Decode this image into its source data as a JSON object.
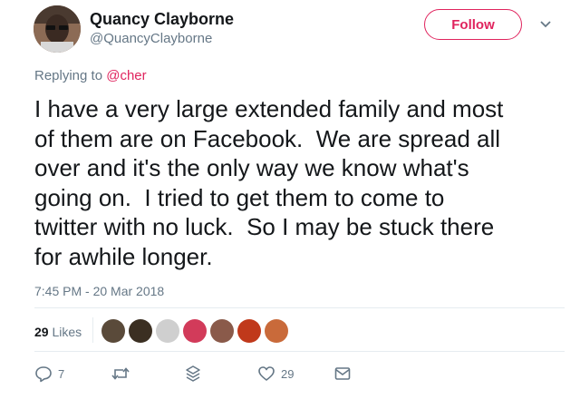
{
  "author": {
    "name": "Quancy Clayborne",
    "handle": "@QuancyClayborne"
  },
  "follow_label": "Follow",
  "reply_context": {
    "prefix": "Replying to",
    "mention": "@cher"
  },
  "tweet": {
    "text": "I have a very large extended family and most\nof them are on Facebook.  We are spread all\nover and it's the only way we know what's\ngoing on.  I tried to get them to come to\ntwitter with no luck.  So I may be stuck there\nfor awhile longer.",
    "timestamp": "7:45 PM - 20 Mar 2018"
  },
  "stats": {
    "likes_count": "29",
    "likes_label": "Likes"
  },
  "likers": [
    {
      "icon": "liker-avatar-1",
      "color": "#5a4a3a"
    },
    {
      "icon": "liker-avatar-2",
      "color": "#3b2f22"
    },
    {
      "icon": "liker-avatar-3",
      "color": "#cfcfcf"
    },
    {
      "icon": "liker-avatar-4",
      "color": "#d23b5a"
    },
    {
      "icon": "liker-avatar-5",
      "color": "#8a5a4a"
    },
    {
      "icon": "liker-avatar-6",
      "color": "#c0391b"
    },
    {
      "icon": "liker-avatar-7",
      "color": "#c96a3a"
    }
  ],
  "actions": {
    "reply_count": "7",
    "retweet_count": "",
    "like_count": "29"
  },
  "colors": {
    "accent": "#e0245e",
    "secondary_text": "#657786",
    "divider": "#e6ecf0"
  }
}
